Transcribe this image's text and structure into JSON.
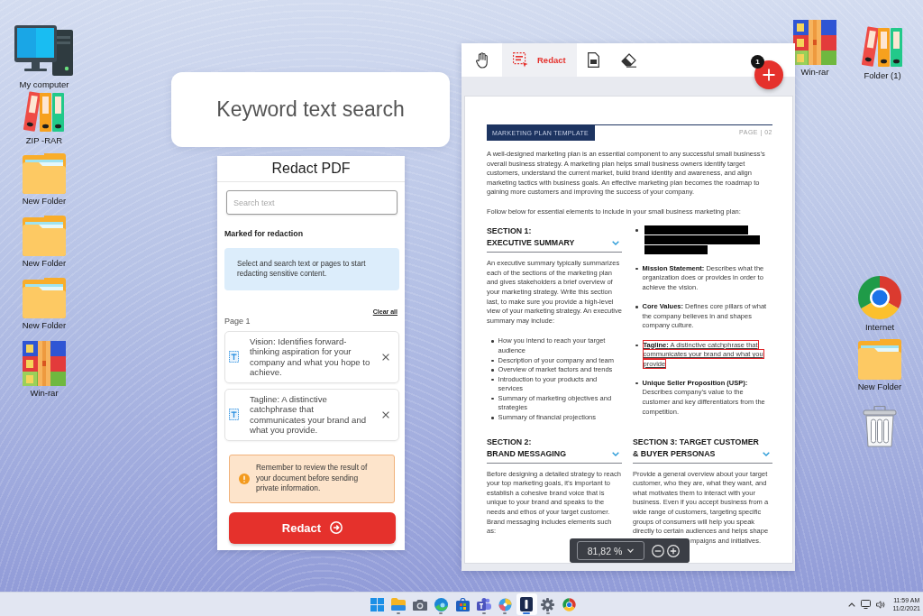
{
  "desktop": {
    "left_icons": [
      {
        "kind": "computer",
        "label": "My computer"
      },
      {
        "kind": "binders",
        "label": "ZIP -RAR"
      },
      {
        "kind": "folder",
        "label": "New Folder"
      },
      {
        "kind": "folder",
        "label": "New Folder"
      },
      {
        "kind": "folder",
        "label": "New Folder"
      },
      {
        "kind": "archive",
        "label": "Win-rar"
      }
    ],
    "right_top_icons": [
      {
        "kind": "archive",
        "label": "Win-rar"
      },
      {
        "kind": "binders",
        "label": "Folder (1)"
      }
    ],
    "right_icons": [
      {
        "kind": "browser",
        "label": "Internet"
      },
      {
        "kind": "folder",
        "label": "New Folder"
      },
      {
        "kind": "trash"
      }
    ]
  },
  "callout": {
    "text": "Keyword text search"
  },
  "redact_panel": {
    "title": "Redact PDF",
    "search": {
      "placeholder": "Search text"
    },
    "section_label": "Marked for redaction",
    "info": "Select and search text or pages to start redacting sensitive content.",
    "clear_all": "Clear all",
    "page_label": "Page 1",
    "items": [
      {
        "text": "Vision: Identifies forward-thinking aspiration for your company and what you hope to achieve."
      },
      {
        "text": "Tagline: A distinctive catchphrase that communicates your brand and what you provide."
      }
    ],
    "warning": "Remember to review the result of your document before sending private information.",
    "button": "Redact"
  },
  "viewer": {
    "tools": [
      {
        "kind": "hand",
        "selected": false
      },
      {
        "kind": "redact",
        "label": "Redact",
        "selected": true
      },
      {
        "kind": "page",
        "selected": false
      },
      {
        "kind": "eraser",
        "selected": false
      }
    ],
    "fab": {
      "badge": "1"
    },
    "document": {
      "header": "MARKETING PLAN TEMPLATE",
      "page_number": "PAGE | 02",
      "intro": "A well-designed marketing plan is an essential component to any successful small business’s overall business strategy. A marketing plan helps small business owners identify target customers, understand the current market, build brand identity and awareness, and align marketing tactics with business goals. An effective marketing plan becomes the roadmap to gaining more customers and improving the success of your company.",
      "lead": "Follow below for essential elements to include in your small business marketing plan:",
      "sections": [
        {
          "heading": "SECTION 1:\nEXECUTIVE SUMMARY",
          "body": "An executive summary typically summarizes each of the sections of the marketing plan and gives stakeholders a brief overview of your marketing strategy. Write this section last, to make sure you provide a high-level view of your marketing strategy. An executive summary may include:",
          "bullets": [
            "How you intend to reach your target audience",
            "Description of your company and team",
            "Overview of market factors and trends",
            "Introduction to your products and services",
            "Summary of marketing objectives and strategies",
            "Summary of financial projections"
          ]
        },
        {
          "heading": "SECTION 2:\nBRAND MESSAGING",
          "body": "Before designing a detailed strategy to reach your top marketing goals, it’s important to establish a cohesive brand voice that is unique to your brand and speaks to the needs and ethos of your target customer. Brand messaging includes elements such as:"
        },
        {
          "heading": "SECTION 3: TARGET CUSTOMER\n& BUYER PERSONAS",
          "body": "Provide a general overview about your target customer, who they are, what they want, and what motivates them to interact with your business. Even if you accept business from a wide range of customers, targeting specific groups of consumers will help you speak directly to certain audiences and helps shape",
          "body_tail": "mpaigns and initiatives."
        }
      ],
      "elements_list": [
        {
          "kind": "redacted"
        },
        {
          "kind": "text",
          "text": "**Mission Statement:** Describes what the organization does or provides in order to achieve the vision.",
          "marked": false
        },
        {
          "kind": "text",
          "text": "**Core Values:** Defines core pillars of what the company believes in and shapes company culture.",
          "marked": false
        },
        {
          "kind": "text",
          "text": "**Tagline:** A distinctive catchphrase that communicates your brand and what you provide",
          "marked": true
        },
        {
          "kind": "text",
          "text": "**Unique Seller Proposition (USP):** Describes company’s value to the customer and key differentiators from the competition.",
          "marked": false
        }
      ]
    },
    "zoom": {
      "value": "81,82 %"
    }
  },
  "taskbar": {
    "apps": [
      {
        "kind": "start",
        "running": false,
        "selected": false
      },
      {
        "kind": "files",
        "running": true,
        "selected": false
      },
      {
        "kind": "camera",
        "running": false,
        "selected": false
      },
      {
        "kind": "edge",
        "running": true,
        "selected": false
      },
      {
        "kind": "store",
        "running": false,
        "selected": false
      },
      {
        "kind": "teams",
        "running": true,
        "selected": false
      },
      {
        "kind": "photos",
        "running": true,
        "selected": false
      },
      {
        "kind": "app",
        "running": true,
        "selected": true
      },
      {
        "kind": "settings",
        "running": true,
        "selected": false
      },
      {
        "kind": "chrome",
        "running": false,
        "selected": false
      }
    ],
    "clock": {
      "time": "11:59 AM",
      "date": "11/2/2021"
    }
  }
}
